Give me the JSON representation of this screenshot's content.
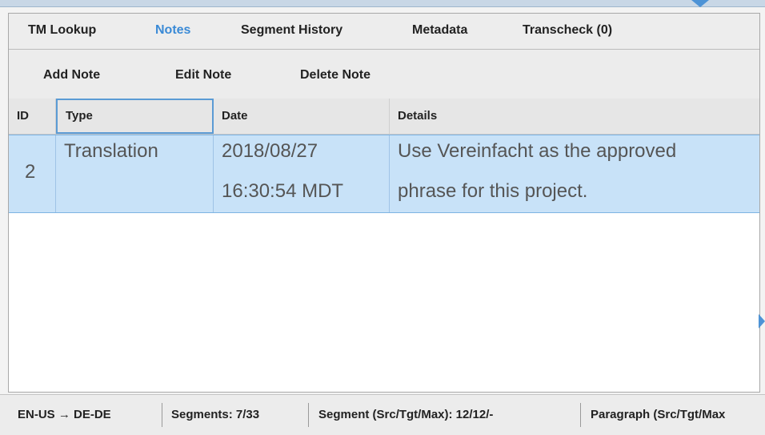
{
  "tabs": [
    {
      "label": "TM Lookup"
    },
    {
      "label": "Notes"
    },
    {
      "label": "Segment History"
    },
    {
      "label": "Metadata"
    },
    {
      "label": "Transcheck (0)"
    }
  ],
  "active_tab": "Notes",
  "toolbar": {
    "add_label": "Add Note",
    "edit_label": "Edit Note",
    "delete_label": "Delete Note"
  },
  "table": {
    "columns": [
      "ID",
      "Type",
      "Date",
      "Details"
    ],
    "rows": [
      {
        "id": "2",
        "type": "Translation",
        "date_line1": "2018/08/27",
        "date_line2": "16:30:54 MDT",
        "details_line1": "Use Vereinfacht as the approved",
        "details_line2": "phrase for this project."
      }
    ]
  },
  "status": {
    "lang": "EN-US → DE-DE",
    "segments": "Segments: 7/33",
    "segment_counts": "Segment (Src/Tgt/Max): 12/12/-",
    "paragraph_counts": "Paragraph (Src/Tgt/Max"
  },
  "colors": {
    "accent": "#3a8ad6",
    "selected_row": "#c8e2f8"
  }
}
